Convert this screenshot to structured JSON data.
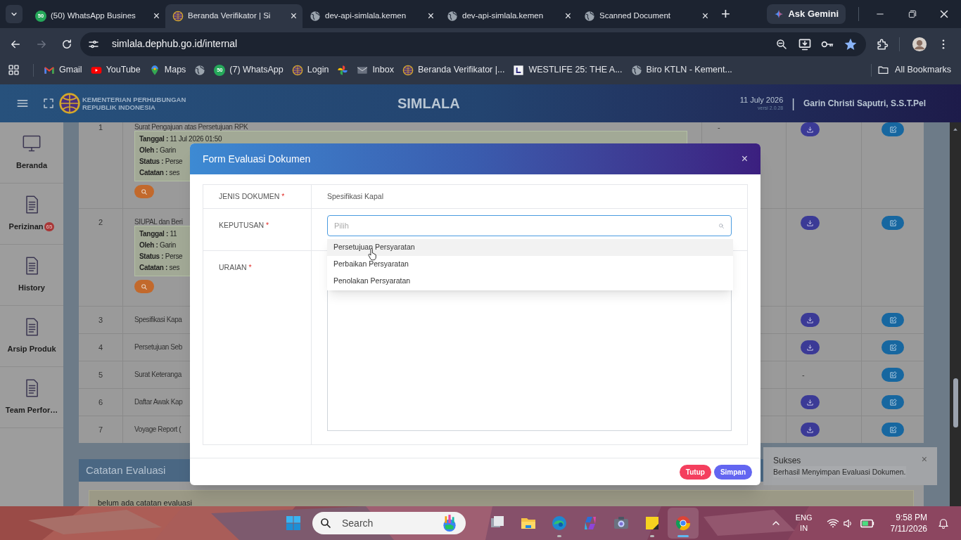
{
  "browser": {
    "tabs": [
      {
        "kind": "whatsapp",
        "badge": "50",
        "title": "(50) WhatsApp Busines",
        "close": "×",
        "selected": false
      },
      {
        "kind": "emblem",
        "title": "Beranda Verifikator | Si",
        "close": "×",
        "selected": true
      },
      {
        "kind": "globe",
        "title": "dev-api-simlala.kemen",
        "close": "×",
        "selected": false
      },
      {
        "kind": "globe",
        "title": "dev-api-simlala.kemen",
        "close": "×",
        "selected": false
      },
      {
        "kind": "globe",
        "title": "Scanned Document",
        "close": "×",
        "selected": false
      }
    ],
    "new_tab": "+",
    "gemini_button": "Ask Gemini",
    "address": "simlala.dephub.go.id/internal",
    "bookmarks": [
      {
        "kind": "gmail",
        "label": "Gmail"
      },
      {
        "kind": "youtube",
        "label": "YouTube"
      },
      {
        "kind": "maps",
        "label": "Maps"
      },
      {
        "kind": "globe"
      },
      {
        "kind": "whatsapp",
        "badge": "50",
        "label": "(7) WhatsApp"
      },
      {
        "kind": "emblem",
        "label": "Login"
      },
      {
        "kind": "pinwheel"
      },
      {
        "kind": "mail",
        "label": "Inbox"
      },
      {
        "kind": "emblem",
        "label": "Beranda Verifikator |..."
      },
      {
        "kind": "square",
        "label": "WESTLIFE 25: THE A..."
      },
      {
        "kind": "globe",
        "label": "Biro KTLN - Kement..."
      }
    ],
    "all_bookmarks": "All Bookmarks"
  },
  "app": {
    "header": {
      "ministry": [
        "KEMENTERIAN PERHUBUNGAN",
        "REPUBLIK INDONESIA"
      ],
      "title": "SIMLALA",
      "date": "11 July 2026",
      "version": "versi 2.0.28",
      "separator": "|",
      "user": "Garin Christi Saputri, S.S.T.Pel"
    },
    "sidebar": [
      {
        "kind": "monitor",
        "label": "Beranda"
      },
      {
        "kind": "document",
        "label": "Perizinan",
        "badge": "65"
      },
      {
        "kind": "document",
        "label": "History"
      },
      {
        "kind": "document",
        "label": "Arsip Produk"
      },
      {
        "kind": "document",
        "label": "Team Perfor…"
      }
    ],
    "table": {
      "rows": [
        {
          "no": "1",
          "document": "Surat Pengajuan atas Persetujuan RPK",
          "details": [
            "**Tanggal :** 11 Jul 2026 01:50",
            "**Oleh :** Garin",
            "**Status :** Perse",
            "**Catatan :** ses"
          ],
          "column_3": "-",
          "download": true,
          "edit": true
        },
        {
          "no": "2",
          "document": "SIUPAL dan Beri",
          "details": [
            "**Tanggal :** 11",
            "**Oleh :** Garin",
            "**Status :** Perse",
            "**Catatan :** ses"
          ],
          "download": true,
          "edit": true
        },
        {
          "no": "3",
          "document": "Spesifikasi Kapa",
          "download": true,
          "edit": true
        },
        {
          "no": "4",
          "document": "Persetujuan Seb",
          "download": true,
          "edit": true
        },
        {
          "no": "5",
          "document": "Surat Keteranga",
          "download": false,
          "download_text": "-",
          "edit": true
        },
        {
          "no": "6",
          "document": "Daftar Awak Kap",
          "download": true,
          "edit": true
        },
        {
          "no": "7",
          "document": "Voyage Report (",
          "download": true,
          "edit": true
        }
      ]
    },
    "panel": {
      "title": "Catatan Evaluasi",
      "note": "belum ada catatan evaluasi"
    },
    "toast": {
      "title": "Sukses",
      "message": "Berhasil Menyimpan Evaluasi Dokumen.",
      "close": "×"
    },
    "modal": {
      "title": "Form Evaluasi Dokumen",
      "close": "×",
      "fields": [
        {
          "kind": "text",
          "label": "JENIS DOKUMEN",
          "marker": "*",
          "value": "Spesifikasi Kapal"
        },
        {
          "kind": "select",
          "label": "KEPUTUSAN",
          "marker": "*",
          "placeholder": "Pilih",
          "expanded": true,
          "options": [
            {
              "label": "Persetujuan Persyaratan",
              "highlighted": true
            },
            {
              "label": "Perbaikan Persyaratan",
              "highlighted": false
            },
            {
              "label": "Penolakan Persyaratan",
              "highlighted": false
            }
          ]
        },
        {
          "kind": "textarea",
          "label": "URAIAN",
          "marker": "*"
        }
      ],
      "buttons": [
        {
          "kind": "danger",
          "label": "Tutup"
        },
        {
          "kind": "primary",
          "label": "Simpan"
        }
      ]
    }
  },
  "taskbar": {
    "search": "Search",
    "apps": [
      {
        "kind": "taskview",
        "running": false,
        "active": false
      },
      {
        "kind": "explorer",
        "running": false,
        "active": false
      },
      {
        "kind": "edge",
        "running": true,
        "active": false
      },
      {
        "kind": "copilot",
        "running": false,
        "active": false
      },
      {
        "kind": "camera",
        "running": false,
        "active": false
      },
      {
        "kind": "sticky",
        "running": true,
        "active": false
      },
      {
        "kind": "chrome",
        "running": true,
        "active": true
      }
    ],
    "language": [
      "ENG",
      "IN"
    ],
    "time": "9:58 PM",
    "date": "7/11/2026"
  }
}
